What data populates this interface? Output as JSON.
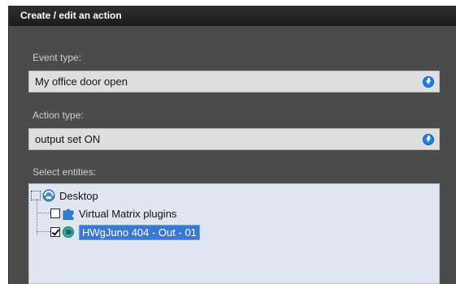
{
  "dialog": {
    "title": "Create / edit an action"
  },
  "event_type": {
    "label": "Event type:",
    "value": "My office door open"
  },
  "action_type": {
    "label": "Action type:",
    "value": "output set ON"
  },
  "entities": {
    "label": "Select entities:",
    "tree": [
      {
        "label": "Desktop",
        "icon": "desktop-globe-icon",
        "checked": false
      },
      {
        "label": "Virtual Matrix plugins",
        "icon": "puzzle-plugin-icon",
        "checked": false
      },
      {
        "label": "HWgJuno 404 - Out - 01",
        "icon": "output-device-icon",
        "checked": true,
        "selected": true
      }
    ]
  },
  "colors": {
    "dialog_bg": "#4b4b4b",
    "titlebar_bg": "#1c1c1c",
    "field_bg": "#dedede",
    "tree_bg": "#dfe6f1",
    "selection": "#3a78d4",
    "dropdown_icon": "#1f7fe5"
  }
}
